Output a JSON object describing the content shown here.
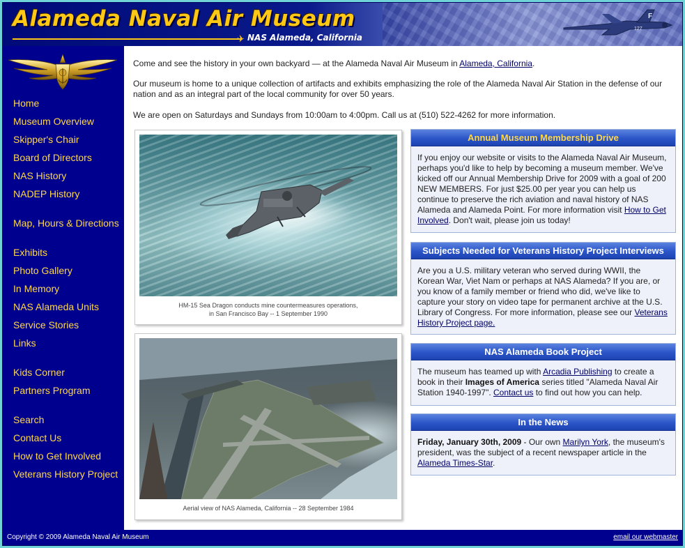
{
  "header": {
    "title": "Alameda Naval Air Museum",
    "subtitle": "NAS Alameda, California",
    "plane_markings": [
      "F",
      "127"
    ]
  },
  "sidebar": {
    "groups": [
      [
        "Home",
        "Museum Overview",
        "Skipper's Chair",
        "Board of Directors",
        "NAS History",
        "NADEP History"
      ],
      [
        "Map, Hours & Directions"
      ],
      [
        "Exhibits",
        "Photo Gallery",
        "In Memory",
        "NAS Alameda Units",
        "Service Stories",
        "Links"
      ],
      [
        "Kids Corner",
        "Partners Program"
      ],
      [
        "Search",
        "Contact Us",
        "How to Get Involved",
        "Veterans History Project"
      ]
    ]
  },
  "intro": {
    "p1_before": "Come and see the history in your own backyard — at the Alameda Naval Air Museum in ",
    "p1_link": "Alameda, California",
    "p1_after": ".",
    "p2": "Our museum is home to a unique collection of artifacts and exhibits emphasizing the role of the Alameda Naval Air Station in the defense of our nation and as an integral part of the local community for over 50 years.",
    "p3": "We are open on Saturdays and Sundays from 10:00am to 4:00pm. Call us at (510) 522-4262 for more information."
  },
  "photos": [
    {
      "caption_line1": "HM-15 Sea Dragon conducts mine countermeasures operations,",
      "caption_line2": "in San Francisco Bay -- 1 September 1990"
    },
    {
      "caption_line1": "Aerial view of NAS Alameda, California -- 28 September 1984",
      "caption_line2": ""
    }
  ],
  "cards": {
    "membership": {
      "title": "Annual Museum Membership Drive",
      "text_before": "If you enjoy our website or visits to the Alameda Naval Air Museum, perhaps you'd like to help by becoming a museum member. We've kicked off our Annual Membership Drive for 2009 with a goal of 200 NEW MEMBERS. For just $25.00 per year you can help us continue to preserve the rich aviation and naval history of NAS Alameda and Alameda Point. For more information visit ",
      "link": "How to Get Involved",
      "text_after": ". Don't wait, please join us today!"
    },
    "veterans": {
      "title": "Subjects Needed for Veterans History Project Interviews",
      "text_before": "Are you a U.S. military veteran who served during WWII, the Korean War, Viet Nam or perhaps at NAS Alameda? If you are, or you know of a family member or friend who did, we've like to capture your story on video tape for permanent archive at the U.S. Library of Congress. For more information, please see our ",
      "link": "Veterans History Project page."
    },
    "book": {
      "title": "NAS Alameda Book Project",
      "text_1": "The museum has teamed up with ",
      "link_1": "Arcadia Publishing",
      "text_2": " to create a book in their ",
      "bold": "Images of America",
      "text_3": " series titled \"Alameda Naval Air Station 1940-1997\". ",
      "link_2": "Contact us",
      "text_4": " to find out how you can help."
    },
    "news": {
      "title": "In the News",
      "date": "Friday, January 30th, 2009",
      "text_1": " - Our own ",
      "link_1": "Marilyn York",
      "text_2": ", the museum's president, was the subject of a recent newspaper article in the ",
      "link_2": "Alameda Times-Star",
      "text_3": "."
    }
  },
  "footer": {
    "copyright": "Copyright © 2009 Alameda Naval Air Museum",
    "webmaster": "email our webmaster"
  },
  "colors": {
    "nav_blue": "#00008e",
    "gold": "#ffc814",
    "nav_link": "#ffd84a",
    "card_head_membership": "#ffd84a",
    "card_head_other": "#ffffff"
  }
}
